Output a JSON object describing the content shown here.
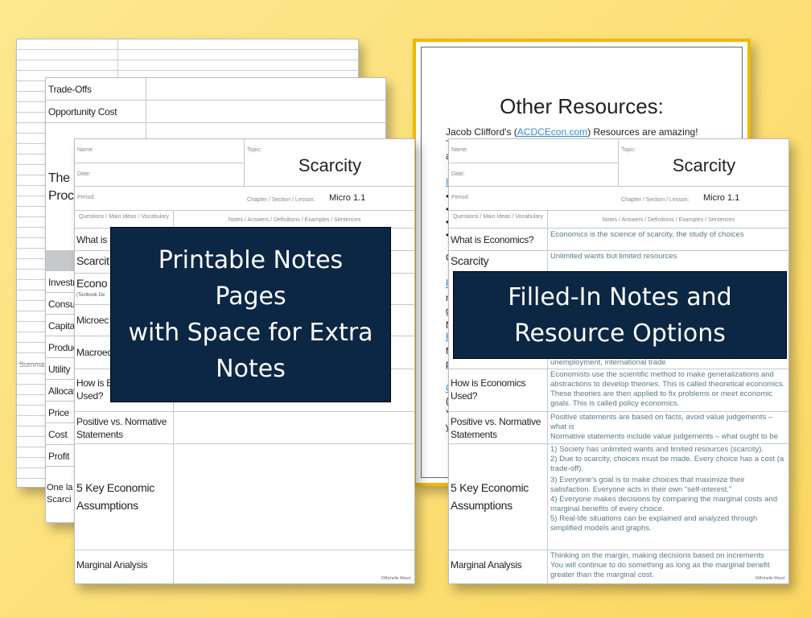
{
  "back_sheet": {
    "left_rows": [
      "Summa",
      "One la",
      "Scarci"
    ]
  },
  "middle_sheet": {
    "rows": [
      "Trade-Offs",
      "Opportunity Cost"
    ],
    "big_text": [
      "The",
      "Proc"
    ],
    "list_items": [
      "Investr",
      "Consu",
      "Capital",
      "Produc",
      "Utility",
      "Allocat",
      "Price",
      "Cost",
      "Profit"
    ]
  },
  "resources_sheet": {
    "title": "Other Resources:",
    "line1_prefix": "Jacob Clifford's (",
    "line1_link": "ACDCEcon.com",
    "line1_suffix": ") Resources are amazing!",
    "line2": "T",
    "line3": "a",
    "link_lines": [
      "In",
      "R",
      "K",
      "C"
    ],
    "bullets": [
      "•",
      "•",
      "•",
      "•"
    ],
    "misc_lines": [
      "C",
      "m",
      "g",
      "N",
      "fo",
      "pr",
      "(N",
      "Yo",
      "yo"
    ]
  },
  "notes_left": {
    "name_label": "Name:",
    "date_label": "Date:",
    "period_label": "Period:",
    "topic_label": "Topic:",
    "topic_value": "Scarcity",
    "chapter_label": "Chapter / Section / Lesson:",
    "chapter_value": "Micro 1.1",
    "col1_head": "Questions / Main Ideas / Vocabulary",
    "col2_head": "Notes / Answers / Definitions / Examples / Sentences",
    "q1": "What is E",
    "q2": "Scarcit",
    "q3": "Econo",
    "q3_note": "(Textbook De",
    "q4": "Microec",
    "q5": "Macroec",
    "q6a": "How is E",
    "q6b": "Used?",
    "q7a": "Positive vs. Normative",
    "q7b": "Statements",
    "q8a": "5 Key Economic",
    "q8b": "Assumptions",
    "q9": "Marginal Analysis",
    "copyright": "©Michelle Wood"
  },
  "notes_right": {
    "name_label": "Name:",
    "date_label": "Date:",
    "period_label": "Period:",
    "topic_label": "Topic:",
    "topic_value": "Scarcity",
    "chapter_label": "Chapter / Section / Lesson:",
    "chapter_value": "Micro 1.1",
    "col1_head": "Questions / Main Ideas / Vocabulary",
    "col2_head": "Notes / Answers / Definitions / Examples / Sentences",
    "q1": "What is Economics?",
    "a1": "Economics is the science of scarcity, the study of choices",
    "q2": "Scarcity",
    "a2": "Unlimited wants but limited resources",
    "a_unemp": "unemployment, international trade",
    "q6a": "How is Economics",
    "q6b": "Used?",
    "a6": "Economists use the scientific method to make generalizations and abstractions to develop theories. This is called theoretical economics. These theories are then applied to fix problems or meet economic goals. This is called policy economics.",
    "q7a": "Positive vs. Normative",
    "q7b": "Statements",
    "a7a": "Positive statements are based on facts, avoid value judgements – what is",
    "a7b": "Normative statements include value judgements – what ought to be",
    "q8a": "5 Key Economic",
    "q8b": "Assumptions",
    "a8_1": "1) Society has unlimited wants and limited resources (scarcity).",
    "a8_2": "2) Due to scarcity, choices must be made. Every choice has a cost (a trade-off).",
    "a8_3": "3) Everyone's goal is to make choices that maximize their satisfaction. Everyone acts in their own \"self-interest.\"",
    "a8_4": "4) Everyone makes decisions by comparing the marginal costs and marginal benefits of every choice.",
    "a8_5": "5) Real-life situations can be explained and analyzed through simplified models and graphs.",
    "q9": "Marginal Analysis",
    "a9a": "Thinking on the margin, making decisions based on increments",
    "a9b": "You will continue to do something as long as the marginal benefit greater than the marginal cost.",
    "copyright": "©Michelle Wood"
  },
  "callout_left": {
    "lines": [
      "Printable Notes",
      "Pages",
      "with Space for Extra",
      "Notes"
    ]
  },
  "callout_right": {
    "lines": [
      "Filled-In Notes and",
      "Resource Options"
    ]
  }
}
